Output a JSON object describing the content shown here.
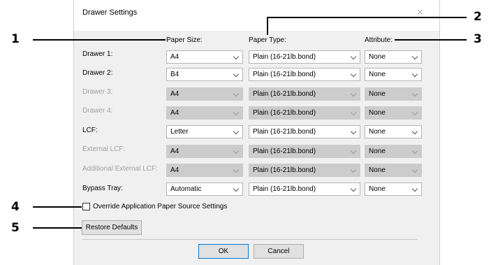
{
  "dialog": {
    "title": "Drawer Settings"
  },
  "headers": {
    "paper_size": "Paper Size:",
    "paper_type": "Paper Type:",
    "attribute": "Attribute:"
  },
  "rows": [
    {
      "label": "Drawer 1:",
      "size": "A4",
      "type": "Plain (16-21lb.bond)",
      "attr": "None",
      "enabled": true
    },
    {
      "label": "Drawer 2:",
      "size": "B4",
      "type": "Plain (16-21lb.bond)",
      "attr": "None",
      "enabled": true
    },
    {
      "label": "Drawer 3:",
      "size": "A4",
      "type": "Plain (16-21lb.bond)",
      "attr": "None",
      "enabled": false
    },
    {
      "label": "Drawer 4:",
      "size": "A4",
      "type": "Plain (16-21lb.bond)",
      "attr": "None",
      "enabled": false
    },
    {
      "label": "LCF:",
      "size": "Letter",
      "type": "Plain (16-21lb.bond)",
      "attr": "None",
      "enabled": true
    },
    {
      "label": "External LCF:",
      "size": "A4",
      "type": "Plain (16-21lb.bond)",
      "attr": "None",
      "enabled": false
    },
    {
      "label": "Additional External LCF:",
      "size": "A4",
      "type": "Plain (16-21lb.bond)",
      "attr": "None",
      "enabled": false
    },
    {
      "label": "Bypass Tray:",
      "size": "Automatic",
      "type": "Plain (16-21lb.bond)",
      "attr": "None",
      "enabled": true
    }
  ],
  "override": {
    "label": "Override Application Paper Source Settings",
    "checked": false
  },
  "buttons": {
    "restore": "Restore Defaults",
    "ok": "OK",
    "cancel": "Cancel"
  },
  "callouts": [
    "1",
    "2",
    "3",
    "4",
    "5"
  ]
}
